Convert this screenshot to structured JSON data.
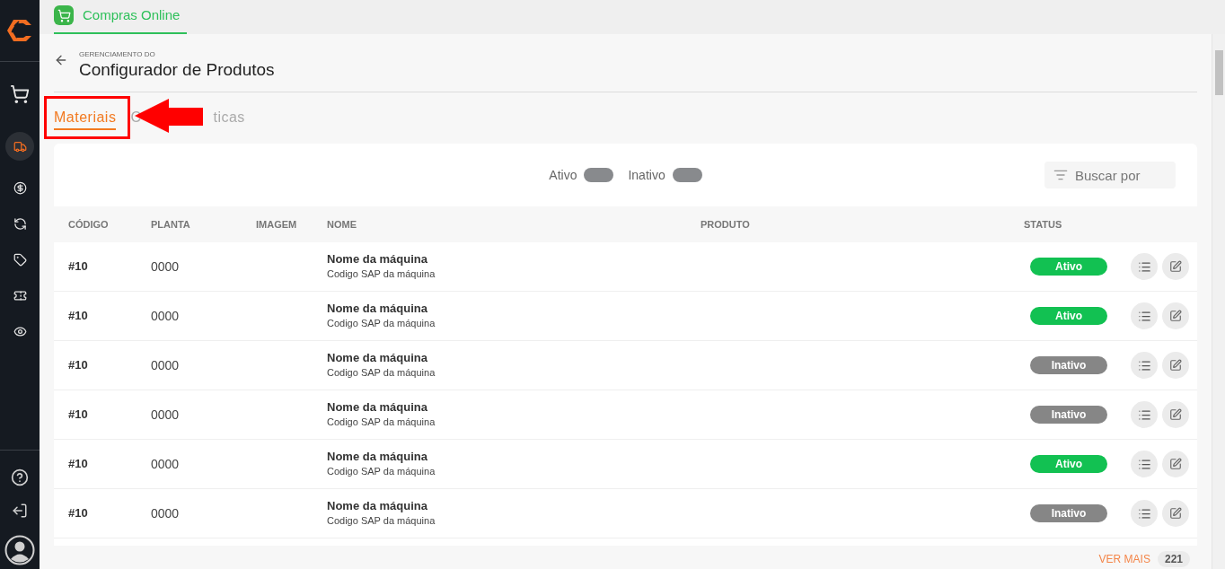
{
  "app_tab": {
    "label": "Compras Online",
    "selected": true
  },
  "sidebar": {
    "items": [
      {
        "kind": "cart",
        "selected": false
      },
      {
        "kind": "truck",
        "selected": true
      },
      {
        "kind": "dollar",
        "selected": false
      },
      {
        "kind": "exchange",
        "selected": false
      },
      {
        "kind": "tag",
        "selected": false
      },
      {
        "kind": "ticket",
        "selected": false
      },
      {
        "kind": "eye",
        "selected": false
      }
    ]
  },
  "header": {
    "overline": "GERENCIAMENTO DO",
    "title": "Configurador de Produtos"
  },
  "tabs": [
    {
      "label_start": "Materiais",
      "selected": true
    },
    {
      "label_start": "C",
      "label_end": "ticas",
      "selected": false
    }
  ],
  "filters": [
    {
      "label": "Ativo",
      "on": false
    },
    {
      "label": "Inativo",
      "on": false
    }
  ],
  "search": {
    "placeholder": "Buscar por"
  },
  "table": {
    "columns": [
      "CÓDIGO",
      "PLANTA",
      "IMAGEM",
      "NOME",
      "PRODUTO",
      "STATUS"
    ],
    "rows": [
      {
        "code": "#10",
        "plant": "0000",
        "name": "Nome da máquina",
        "sap": "Codigo SAP da máquina",
        "status": "Ativo",
        "active": true
      },
      {
        "code": "#10",
        "plant": "0000",
        "name": "Nome da máquina",
        "sap": "Codigo SAP da máquina",
        "status": "Ativo",
        "active": true
      },
      {
        "code": "#10",
        "plant": "0000",
        "name": "Nome da máquina",
        "sap": "Codigo SAP da máquina",
        "status": "Inativo",
        "active": false
      },
      {
        "code": "#10",
        "plant": "0000",
        "name": "Nome da máquina",
        "sap": "Codigo SAP da máquina",
        "status": "Inativo",
        "active": false
      },
      {
        "code": "#10",
        "plant": "0000",
        "name": "Nome da máquina",
        "sap": "Codigo SAP da máquina",
        "status": "Ativo",
        "active": true
      },
      {
        "code": "#10",
        "plant": "0000",
        "name": "Nome da máquina",
        "sap": "Codigo SAP da máquina",
        "status": "Inativo",
        "active": false
      }
    ]
  },
  "footer": {
    "link": "VER MAIS",
    "count": "221"
  }
}
